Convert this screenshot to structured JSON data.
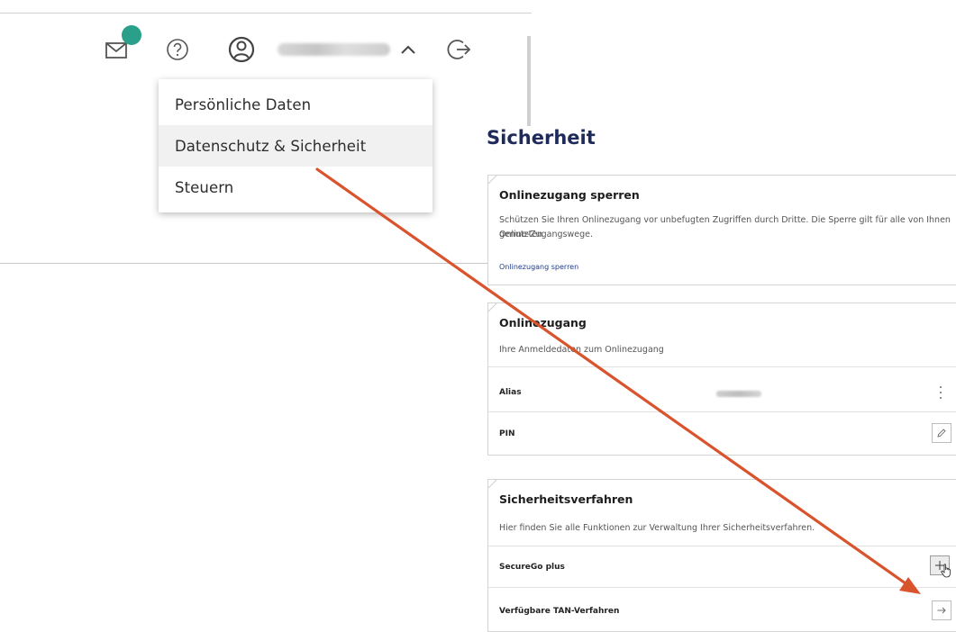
{
  "header": {
    "icons": [
      "mail-icon",
      "help-icon",
      "user-icon",
      "chevron-up-icon",
      "logout-icon"
    ],
    "badge_color": "#2aa08a"
  },
  "menu": {
    "items": [
      {
        "label": "Persönliche Daten"
      },
      {
        "label": "Datenschutz & Sicherheit"
      },
      {
        "label": "Steuern"
      }
    ]
  },
  "page": {
    "title": "Sicherheit",
    "title_color": "#1e2a5a"
  },
  "sections": {
    "lock": {
      "title": "Onlinezugang sperren",
      "text_line1": "Schützen Sie Ihren Onlinezugang vor unbefugten Zugriffen durch Dritte. Die Sperre gilt für alle von Ihnen genutzten",
      "text_line2": "Online-Zugangswege.",
      "link": "Onlinezugang sperren"
    },
    "access": {
      "title": "Onlinezugang",
      "subtitle": "Ihre Anmeldedaten zum Onlinezugang",
      "alias_label": "Alias",
      "pin_label": "PIN"
    },
    "security": {
      "title": "Sicherheitsverfahren",
      "subtitle": "Hier finden Sie alle Funktionen zur Verwaltung Ihrer Sicherheitsverfahren.",
      "securego_label": "SecureGo plus",
      "tan_label": "Verfügbare TAN-Verfahren"
    }
  },
  "annotation": {
    "arrow_color": "#d9532c"
  }
}
